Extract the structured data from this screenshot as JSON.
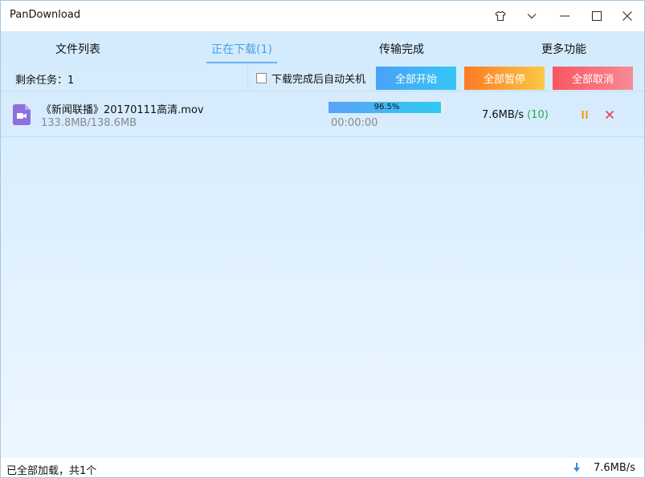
{
  "window": {
    "title": "PanDownload"
  },
  "tabs": [
    {
      "label": "文件列表"
    },
    {
      "label": "正在下载(1)"
    },
    {
      "label": "传输完成"
    },
    {
      "label": "更多功能"
    }
  ],
  "toolbar": {
    "remaining_tasks": "剩余任务：1",
    "shutdown_label": "下载完成后自动关机",
    "start_all": "全部开始",
    "pause_all": "全部暂停",
    "cancel_all": "全部取消"
  },
  "downloads": [
    {
      "name": "《新闻联播》20170111高清.mov",
      "size": "133.8MB/138.6MB",
      "progress": 0.965,
      "progress_label": "96.5%",
      "time": "00:00:00",
      "speed": "7.6MB/s",
      "connections": "(10)"
    }
  ],
  "status": {
    "text": "已全部加载，共1个",
    "speed": "7.6MB/s"
  },
  "colors": {
    "accent": "#4a9fe8",
    "start": "#4aa1f7",
    "pause": "#fd7a25",
    "cancel": "#fa5661",
    "connections": "#2aa84a"
  },
  "icons": {
    "skin": "shirt-icon",
    "menu": "chevron-down-icon",
    "minimize": "minimize-icon",
    "maximize": "maximize-icon",
    "close": "close-icon",
    "file": "video-file-icon",
    "row_pause": "pause-icon",
    "row_cancel": "cancel-icon",
    "status": "download-arrow-icon"
  }
}
